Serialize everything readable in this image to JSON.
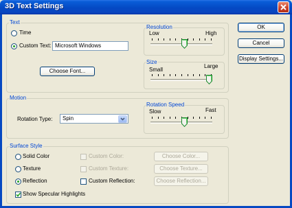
{
  "window": {
    "title": "3D Text Settings"
  },
  "text_group": {
    "legend": "Text",
    "time_label": "Time",
    "custom_text_label": "Custom Text:",
    "custom_text_value": "Microsoft Windows",
    "choose_font_label": "Choose Font..."
  },
  "resolution": {
    "legend": "Resolution",
    "low": "Low",
    "high": "High"
  },
  "size": {
    "legend": "Size",
    "small": "Small",
    "large": "Large"
  },
  "motion": {
    "legend": "Motion",
    "rotation_type_label": "Rotation Type:",
    "rotation_type_value": "Spin"
  },
  "rotation_speed": {
    "legend": "Rotation Speed",
    "slow": "Slow",
    "fast": "Fast"
  },
  "surface": {
    "legend": "Surface Style",
    "solid_color": "Solid Color",
    "texture": "Texture",
    "reflection": "Reflection",
    "custom_color": "Custom Color:",
    "custom_texture": "Custom Texture:",
    "custom_reflection": "Custom Reflection:",
    "choose_color": "Choose Color...",
    "choose_texture": "Choose Texture...",
    "choose_reflection": "Choose Reflection...",
    "specular": "Show Specular Highlights"
  },
  "buttons": {
    "ok": "OK",
    "cancel": "Cancel",
    "display_settings": "Display Settings..."
  },
  "state": {
    "text_mode": "custom",
    "surface_style": "reflection",
    "custom_reflection_checked": false,
    "specular_checked": true,
    "resolution_level": 0.55,
    "size_level": 1.0,
    "speed_level": 0.55
  },
  "colors": {
    "group_label": "#0046d5",
    "title_bar": "#0449c4",
    "dialog_bg": "#ece9d8"
  }
}
